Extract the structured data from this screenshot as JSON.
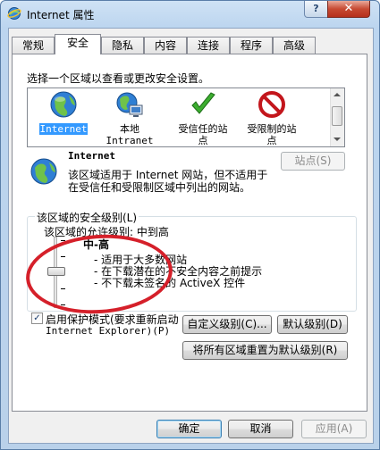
{
  "window": {
    "title": "Internet 属性",
    "help_label": "?",
    "close_label": "✕"
  },
  "tabs": [
    {
      "label": "常规"
    },
    {
      "label": "安全"
    },
    {
      "label": "隐私"
    },
    {
      "label": "内容"
    },
    {
      "label": "连接"
    },
    {
      "label": "程序"
    },
    {
      "label": "高级"
    }
  ],
  "active_tab": "安全",
  "security": {
    "zone_prompt": "选择一个区域以查看或更改安全设置。",
    "zones": [
      {
        "name": "Internet",
        "icon": "globe-icon",
        "selected": true
      },
      {
        "name": "本地 Intranet",
        "line1": "本地",
        "line2": "Intranet",
        "icon": "local-intranet-icon"
      },
      {
        "name": "受信任的站点",
        "line1": "受信任的站",
        "line2": "点",
        "icon": "trusted-check-icon"
      },
      {
        "name": "受限制的站点",
        "line1": "受限制的站",
        "line2": "点",
        "icon": "restricted-icon"
      }
    ],
    "selected_zone": {
      "title": "Internet",
      "desc_line1": "该区域适用于 Internet 网站，但不适用于",
      "desc_line2": "在受信任和受限制区域中列出的网站。",
      "sites_button": "站点(S)"
    },
    "level_group_title": "该区域的安全级别(L)",
    "allowed_levels": "该区域的允许级别: 中到高",
    "level_name": "中-高",
    "level_bullets": [
      "- 适用于大多数网站",
      "- 在下载潜在的不安全内容之前提示",
      "- 不下载未签名的 ActiveX 控件"
    ],
    "slider_level_fraction": 0.55,
    "protected_mode": {
      "checked": true,
      "label_line1": "启用保护模式(要求重新启动",
      "label_line2": "Internet Explorer)(P)"
    },
    "custom_level_button": "自定义级别(C)...",
    "default_level_button": "默认级别(D)",
    "reset_all_button": "将所有区域重置为默认级别(R)"
  },
  "footer": {
    "ok": "确定",
    "cancel": "取消",
    "apply": "应用(A)"
  },
  "colors": {
    "accent": "#3399ff",
    "annotation_ellipse": "#d5202a"
  }
}
